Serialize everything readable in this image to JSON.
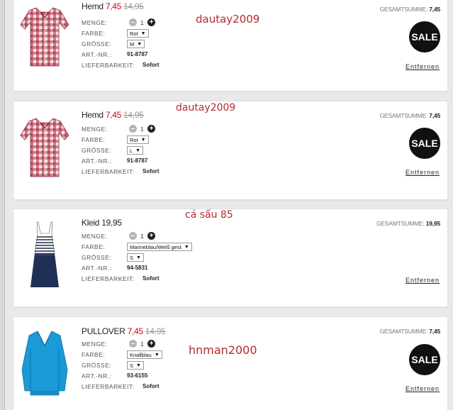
{
  "items": [
    {
      "name": "Hemd",
      "price": "7,45",
      "old_price": "14,95",
      "quantity": "1",
      "color": "Rot",
      "size": "M",
      "article_no": "91-8787",
      "availability": "Sofort",
      "total": "7,45",
      "sale": true,
      "image": "checkered-shirt"
    },
    {
      "name": "Hemd",
      "price": "7,45",
      "old_price": "14,95",
      "quantity": "1",
      "color": "Rot",
      "size": "L",
      "article_no": "91-8787",
      "availability": "Sofort",
      "total": "7,45",
      "sale": true,
      "image": "checkered-shirt"
    },
    {
      "name": "Kleid",
      "price": "19,95",
      "quantity": "1",
      "color": "Marineblau/Weiß gest",
      "size": "S",
      "article_no": "94-5831",
      "availability": "Sofort",
      "total": "19,95",
      "sale": false,
      "image": "striped-dress"
    },
    {
      "name": "PULLOVER",
      "price": "7,45",
      "old_price": "14,95",
      "quantity": "1",
      "color": "Knallblau",
      "size": "S",
      "article_no": "93-6155",
      "availability": "Sofort",
      "total": "7,45",
      "sale": true,
      "image": "blue-pullover"
    }
  ],
  "labels": {
    "quantity": "MENGE:",
    "color": "FARBE:",
    "size": "GRÖSSE:",
    "article_no": "ART.-NR.:",
    "availability": "LIEFERBARKEIT:",
    "total": "GESAMTSUMME:",
    "remove": "Entfernen",
    "sale": "SALE",
    "minus": "–",
    "plus": "+",
    "dropdown_arrow": "▼"
  },
  "overlays": [
    "dautay2009",
    "dautay2009",
    "cá sấu 85",
    "hnman2000"
  ],
  "colors": {
    "sale_price": "#d0021b",
    "old_price": "#999999",
    "watermark": "#b52a2a",
    "sale_badge": "#111111"
  }
}
